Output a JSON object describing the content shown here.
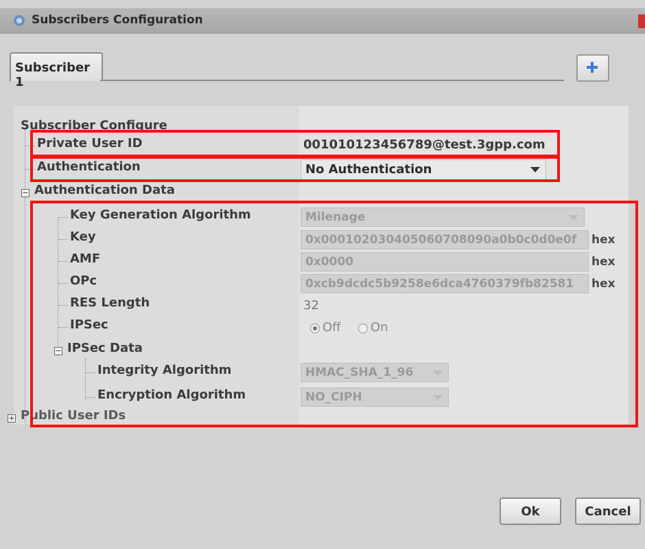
{
  "window": {
    "title": "Subscribers Configuration"
  },
  "tabs": [
    {
      "label": "Subscriber 1",
      "active": true
    }
  ],
  "add_tab_icon": "plus-icon",
  "section": {
    "title": "Subscriber Configure"
  },
  "private_user_id": {
    "label": "Private User ID",
    "value": "001010123456789@test.3gpp.com"
  },
  "authentication": {
    "label": "Authentication",
    "value": "No Authentication"
  },
  "authentication_data": {
    "label": "Authentication Data",
    "key_generation_algorithm": {
      "label": "Key Generation Algorithm",
      "value": "Milenage"
    },
    "key": {
      "label": "Key",
      "value": "0x000102030405060708090a0b0c0d0e0f",
      "unit": "hex"
    },
    "amf": {
      "label": "AMF",
      "value": "0x0000",
      "unit": "hex"
    },
    "opc": {
      "label": "OPc",
      "value": "0xcb9dcdc5b9258e6dca4760379fb82581",
      "unit": "hex"
    },
    "res_length": {
      "label": "RES Length",
      "value": "32"
    },
    "ipsec": {
      "label": "IPSec",
      "options": [
        "Off",
        "On"
      ],
      "selected": "Off"
    },
    "ipsec_data": {
      "label": "IPSec Data",
      "integrity_algorithm": {
        "label": "Integrity Algorithm",
        "value": "HMAC_SHA_1_96"
      },
      "encryption_algorithm": {
        "label": "Encryption Algorithm",
        "value": "NO_CIPH"
      }
    }
  },
  "public_user_ids": {
    "label": "Public User IDs"
  },
  "buttons": {
    "ok": "Ok",
    "cancel": "Cancel"
  },
  "colors": {
    "highlight": "#f01414",
    "panel": "#dcdcdc",
    "accent": "#3a7bd5"
  }
}
